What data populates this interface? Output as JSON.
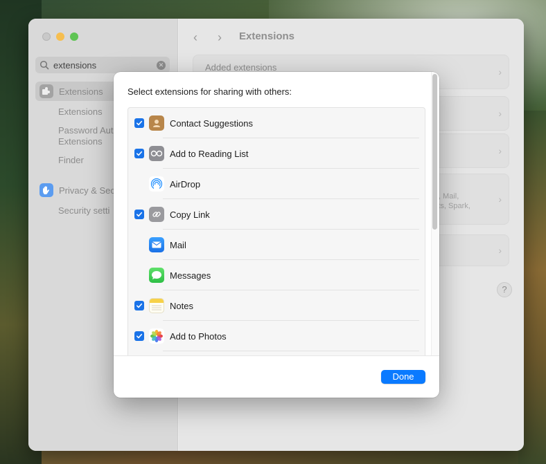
{
  "window": {
    "search": {
      "value": "extensions"
    },
    "sidebar": {
      "items": [
        {
          "label": "Extensions",
          "icon": "puzzle-icon",
          "color": "#9d9d9d"
        },
        {
          "label": "Privacy & Sec",
          "icon": "hand-icon",
          "color": "#5b9cf0"
        }
      ],
      "sub_items": [
        {
          "label": "Extensions"
        },
        {
          "label": "Password Autofill\nExtensions"
        },
        {
          "label": "Finder"
        },
        {
          "label": "Security setti"
        }
      ]
    },
    "main": {
      "title": "Extensions",
      "added_extensions_label": "Added extensions",
      "card_desc": "orm, Mail,\nrtcuts, Spark,",
      "help_label": "?"
    }
  },
  "dialog": {
    "title": "Select extensions for sharing with others:",
    "items": [
      {
        "label": "Contact Suggestions",
        "checked": true,
        "icon": "contact-suggestions-icon",
        "color": "#b8864a"
      },
      {
        "label": "Add to Reading List",
        "checked": true,
        "icon": "reading-list-icon",
        "color": "#8e8e93"
      },
      {
        "label": "AirDrop",
        "checked": false,
        "icon": "airdrop-icon",
        "color": "#1a8cff"
      },
      {
        "label": "Copy Link",
        "checked": true,
        "icon": "link-icon",
        "color": "#8e8e93"
      },
      {
        "label": "Mail",
        "checked": false,
        "icon": "mail-icon",
        "color": "#1a82f0"
      },
      {
        "label": "Messages",
        "checked": false,
        "icon": "messages-icon",
        "color": "#34c759"
      },
      {
        "label": "Notes",
        "checked": true,
        "icon": "notes-icon",
        "color": "#f7d148"
      },
      {
        "label": "Add to Photos",
        "checked": true,
        "icon": "photos-icon",
        "color": "#ff9500"
      }
    ],
    "done_label": "Done",
    "accent": "#0a7aff"
  }
}
